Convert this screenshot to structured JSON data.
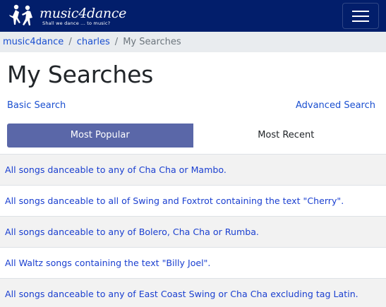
{
  "navbar": {
    "brand_title": "music4dance",
    "brand_tagline": "Shall we dance ... to music?",
    "bg_color": "#021e6b"
  },
  "breadcrumb": {
    "items": [
      "music4dance",
      "charles"
    ],
    "current": "My Searches"
  },
  "page": {
    "title": "My Searches",
    "basic_search_label": "Basic Search",
    "advanced_search_label": "Advanced Search"
  },
  "tabs": {
    "most_popular": "Most Popular",
    "most_recent": "Most Recent",
    "active_color": "#5a67a8"
  },
  "searches": [
    "All songs danceable to any of Cha Cha or Mambo.",
    "All songs danceable to all of Swing and Foxtrot containing the text \"Cherry\".",
    "All songs danceable to any of Bolero, Cha Cha or Rumba.",
    "All Waltz songs containing the text \"Billy Joel\".",
    "All songs danceable to any of East Coast Swing or Cha Cha excluding tag Latin."
  ]
}
